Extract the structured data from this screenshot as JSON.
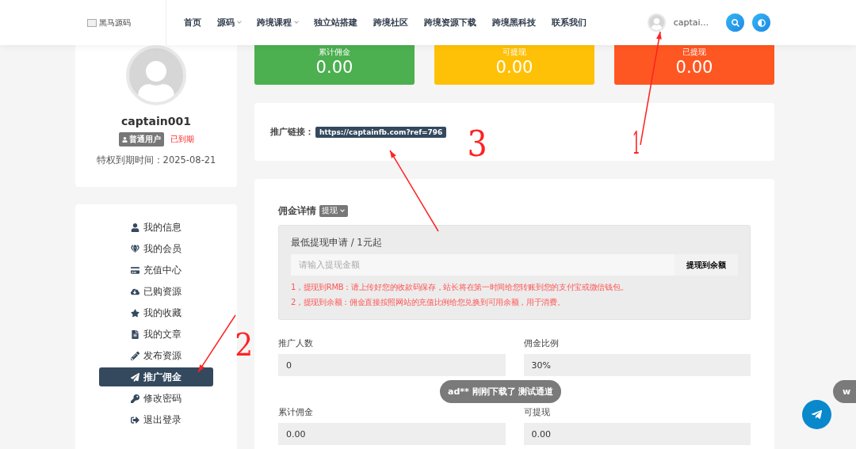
{
  "header": {
    "logo": "黑马源码",
    "nav": [
      {
        "label": "首页",
        "dropdown": false
      },
      {
        "label": "源码",
        "dropdown": true
      },
      {
        "label": "跨境课程",
        "dropdown": true
      },
      {
        "label": "独立站搭建",
        "dropdown": false
      },
      {
        "label": "跨境社区",
        "dropdown": false
      },
      {
        "label": "跨境资源下载",
        "dropdown": false
      },
      {
        "label": "跨境黑科技",
        "dropdown": false
      },
      {
        "label": "联系我们",
        "dropdown": false
      }
    ],
    "user": "captai..."
  },
  "profile": {
    "username": "captain001",
    "badge": "普通用户",
    "status": "已到期",
    "expiry": "特权到期时间：2025-08-21"
  },
  "menu": [
    {
      "label": "我的信息",
      "selected": false
    },
    {
      "label": "我的会员",
      "selected": false
    },
    {
      "label": "充值中心",
      "selected": false
    },
    {
      "label": "已购资源",
      "selected": false
    },
    {
      "label": "我的收藏",
      "selected": false
    },
    {
      "label": "我的文章",
      "selected": false
    },
    {
      "label": "发布资源",
      "selected": false
    },
    {
      "label": "推广佣金",
      "selected": true
    },
    {
      "label": "修改密码",
      "selected": false
    },
    {
      "label": "退出登录",
      "selected": false
    }
  ],
  "stats": [
    {
      "label": "累计佣金",
      "value": "0.00",
      "color": "#4caf50"
    },
    {
      "label": "可提现",
      "value": "0.00",
      "color": "#ffc107"
    },
    {
      "label": "已提现",
      "value": "0.00",
      "color": "#ff5722"
    }
  ],
  "referral": {
    "label": "推广链接：",
    "link": "https://captainfb.com?ref=796"
  },
  "commission": {
    "title": "佣金详情",
    "mode": "提现",
    "min_note": "最低提现申请 / 1元起",
    "placeholder": "请输入提现金额",
    "button": "提现到余额",
    "notes": [
      "1，提现到RMB：请上传好您的收款码保存，站长将在第一时间给您转账到您的支付宝或微信钱包。",
      "2，提现到余额：佣金直接按照网站的充值比例给您兑换到可用余额，用于消费。"
    ],
    "fields": [
      {
        "label": "推广人数",
        "value": "0"
      },
      {
        "label": "佣金比例",
        "value": "30%"
      },
      {
        "label": "累计佣金",
        "value": "0.00"
      },
      {
        "label": "可提现",
        "value": "0.00"
      }
    ]
  },
  "toast": "ad** 刚刚下载了 测试通道",
  "side_pill": "w",
  "annotations": [
    "1",
    "2",
    "3"
  ]
}
